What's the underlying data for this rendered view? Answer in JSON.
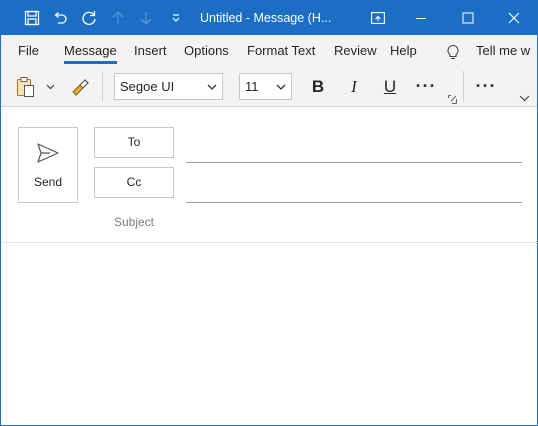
{
  "titlebar": {
    "title": "Untitled  -  Message (H...",
    "bg": "#1c6ec4",
    "icons": [
      "save-icon",
      "undo-icon",
      "redo-icon",
      "up-arrow-icon",
      "down-arrow-icon",
      "qat-dropdown-icon",
      "restore-ribbon-icon",
      "minimize-icon",
      "maximize-icon",
      "close-icon"
    ]
  },
  "tabs": {
    "items": [
      "File",
      "Message",
      "Insert",
      "Options",
      "Format Text",
      "Review",
      "Help"
    ],
    "active": "Message",
    "tell_me": "Tell me w"
  },
  "toolbar": {
    "font_name": "Segoe UI",
    "font_size": "11",
    "bold": "B",
    "italic": "I",
    "underline": "U",
    "more": "···",
    "more2": "···",
    "icons": [
      "paste-icon",
      "format-painter-icon",
      "dialog-launcher-icon",
      "ribbon-collapse-icon"
    ]
  },
  "compose": {
    "send_label": "Send",
    "to_label": "To",
    "cc_label": "Cc",
    "subject_label": "Subject",
    "to_value": "",
    "cc_value": "",
    "subject_value": ""
  }
}
